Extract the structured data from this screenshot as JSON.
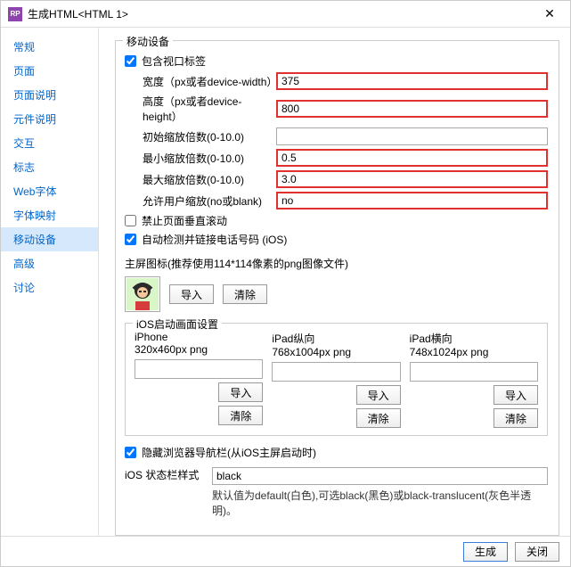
{
  "titlebar": {
    "icon_text": "RP",
    "title": "生成HTML<HTML 1>"
  },
  "sidebar": {
    "items": [
      {
        "label": "常规"
      },
      {
        "label": "页面"
      },
      {
        "label": "页面说明"
      },
      {
        "label": "元件说明"
      },
      {
        "label": "交互"
      },
      {
        "label": "标志"
      },
      {
        "label": "Web字体"
      },
      {
        "label": "字体映射"
      },
      {
        "label": "移动设备"
      },
      {
        "label": "高级"
      },
      {
        "label": "讨论"
      }
    ],
    "active_index": 8
  },
  "mobile": {
    "group_title": "移动设备",
    "include_viewport_label": "包含视口标签",
    "include_viewport_checked": true,
    "fields": {
      "width": {
        "label": "宽度（px或者device-width）",
        "value": "375",
        "highlight": true
      },
      "height": {
        "label": "高度（px或者device-height）",
        "value": "800",
        "highlight": true
      },
      "initial_scale": {
        "label": "初始缩放倍数(0-10.0)",
        "value": "",
        "highlight": false
      },
      "min_scale": {
        "label": "最小缩放倍数(0-10.0)",
        "value": "0.5",
        "highlight": true
      },
      "max_scale": {
        "label": "最大缩放倍数(0-10.0)",
        "value": "3.0",
        "highlight": true
      },
      "user_scalable": {
        "label": "允许用户缩放(no或blank)",
        "value": "no",
        "highlight": true
      }
    },
    "disable_vscroll_label": "禁止页面垂直滚动",
    "disable_vscroll_checked": false,
    "auto_detect_phone_label": "自动检测并链接电话号码 (iOS)",
    "auto_detect_phone_checked": true,
    "home_icon_label": "主屏图标(推荐使用114*114像素的png图像文件)",
    "import_btn": "导入",
    "clear_btn": "清除",
    "splash": {
      "group_title": "iOS启动画面设置",
      "columns": [
        {
          "device": "iPhone",
          "size": "320x460px png"
        },
        {
          "device": "iPad纵向",
          "size": "768x1004px png"
        },
        {
          "device": "iPad横向",
          "size": "748x1024px png"
        }
      ]
    },
    "hide_navbar_label": "隐藏浏览器导航栏(从iOS主屏启动时)",
    "hide_navbar_checked": true,
    "ios_statusbar": {
      "label": "iOS 状态栏样式",
      "value": "black",
      "hint": "默认值为default(白色),可选black(黑色)或black-translucent(灰色半透明)。"
    }
  },
  "footer": {
    "generate": "生成",
    "close": "关闭"
  }
}
